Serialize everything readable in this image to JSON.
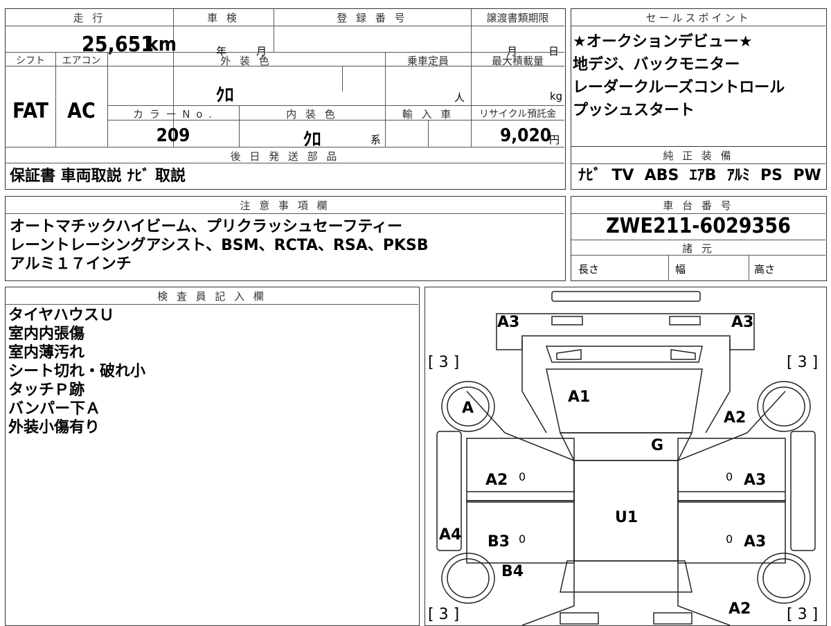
{
  "top_info": {
    "mileage_label": "走 行",
    "mileage_value": "25,651",
    "mileage_unit": "km",
    "inspection_label": "車 検",
    "inspection_year": "年",
    "inspection_month": "月",
    "registration_label": "登 録 番 号",
    "transfer_deadline_label": "譲渡書類期限",
    "transfer_month": "月",
    "transfer_day": "日",
    "shift_label": "シフト",
    "shift_value": "FAT",
    "ac_label": "エアコン",
    "ac_value": "AC",
    "ext_color_label": "外 装 色",
    "ext_color_value": "ｸﾛ",
    "capacity_label": "乗車定員",
    "capacity_unit": "人",
    "max_load_label": "最大積載量",
    "max_load_unit": "kg",
    "color_no_label": "カ ラ ー N o .",
    "color_no_value": "209",
    "int_color_label": "内 装 色",
    "int_color_value": "ｸﾛ",
    "int_color_suffix": "系",
    "import_label": "輸 入 車",
    "recycle_label": "リサイクル預託金",
    "recycle_value": "9,020",
    "recycle_unit": "円",
    "later_parts_label": "後 日 発 送 部 品",
    "later_parts_value": "保証書 車両取説 ﾅﾋﾞ 取説"
  },
  "sales_points": {
    "label": "セールスポイント",
    "lines": [
      "★オークションデビュー★",
      "地デジ、バックモニター",
      "レーダークルーズコントロール",
      "プッシュスタート"
    ]
  },
  "genuine_equipment": {
    "label": "純 正 装 備",
    "value": "ﾅﾋﾞ  TV  ABS  ｴｱB  ｱﾙﾐ  PS  PW"
  },
  "notes": {
    "label": "注 意 事 項 欄",
    "lines": [
      "オートマチックハイビーム、プリクラッシュセーフティー",
      "レーントレーシングアシスト、BSM、RCTA、RSA、PKSB",
      "アルミ１７インチ"
    ]
  },
  "chassis": {
    "label": "車 台 番 号",
    "value": "ZWE211-6029356",
    "spec_label": "諸 元",
    "length_label": "長さ",
    "width_label": "幅",
    "height_label": "高さ"
  },
  "inspector": {
    "label": "検 査 員 記 入 欄",
    "lines": [
      "タイヤハウスＵ",
      "室内内張傷",
      "室内薄汚れ",
      "シート切れ・破れ小",
      "タッチＰ跡",
      "バンパー下Ａ",
      "外装小傷有り"
    ]
  },
  "diagram": {
    "marks": {
      "front_left": "A3",
      "front_right": "A3",
      "tire_fl": "[ 3 ]",
      "tire_fr": "[ 3 ]",
      "tire_rl": "[ 3 ]",
      "tire_rr": "[ 3 ]",
      "hood": "A1",
      "left_front_fender": "A",
      "right_front_fender": "A2",
      "windshield": "G",
      "left_front_door": "A2",
      "right_front_door": "A3",
      "roof": "U1",
      "left_sill": "A4",
      "left_rear_door": "B3",
      "right_rear_door": "A3",
      "left_rear_fender": "B4",
      "right_rear_fender": "A2",
      "zero1": "0",
      "zero2": "0",
      "zero3": "0",
      "zero4": "0"
    }
  }
}
